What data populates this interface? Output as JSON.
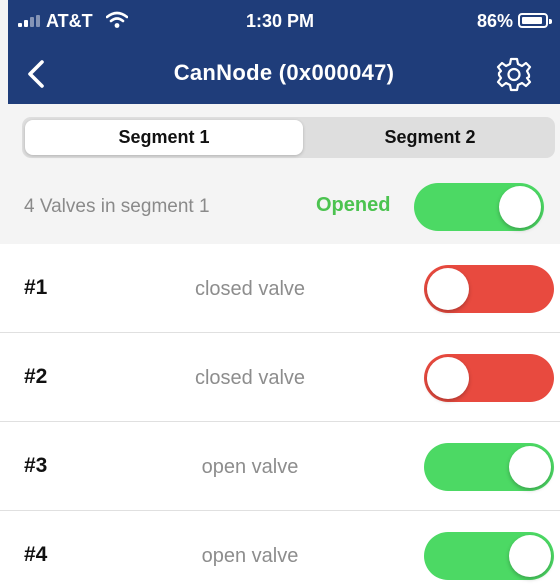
{
  "status_bar": {
    "carrier": "AT&T",
    "time": "1:30 PM",
    "battery": "86%"
  },
  "nav": {
    "title": "CanNode (0x000047)"
  },
  "segments": [
    {
      "label": "Segment 1",
      "selected": true
    },
    {
      "label": "Segment 2",
      "selected": false
    }
  ],
  "summary": {
    "text": "4 Valves in segment 1",
    "state": "Opened",
    "toggle_on": true
  },
  "valves": [
    {
      "number": "#1",
      "label": "closed valve",
      "on": false
    },
    {
      "number": "#2",
      "label": "closed valve",
      "on": false
    },
    {
      "number": "#3",
      "label": "open valve",
      "on": true
    },
    {
      "number": "#4",
      "label": "open valve",
      "on": true
    }
  ],
  "colors": {
    "nav_bg": "#1f3d7a",
    "on": "#4cd964",
    "off": "#e84a3f",
    "state_text": "#4cc350"
  }
}
